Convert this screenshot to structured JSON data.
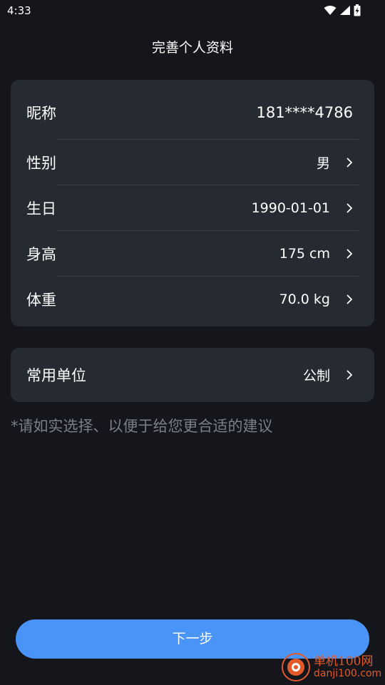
{
  "status_bar": {
    "time": "4:33",
    "icons": [
      "wifi-icon",
      "signal-icon",
      "battery-icon"
    ]
  },
  "page": {
    "title": "完善个人资料"
  },
  "profile": {
    "nickname": {
      "label": "昵称",
      "value": "181****4786"
    },
    "gender": {
      "label": "性别",
      "value": "男"
    },
    "birthday": {
      "label": "生日",
      "value": "1990-01-01"
    },
    "height": {
      "label": "身高",
      "value": "175 cm"
    },
    "weight": {
      "label": "体重",
      "value": "70.0 kg"
    }
  },
  "units": {
    "label": "常用单位",
    "value": "公制"
  },
  "hint": "*请如实选择、以便于给您更合适的建议",
  "next_button": "下一步",
  "watermark": {
    "title": "单机100网",
    "url": "danji100.com"
  },
  "colors": {
    "background": "#14161b",
    "card": "#262a31",
    "accent": "#4a94f7",
    "hint_text": "#7a7f87",
    "watermark": "#e25a2a"
  }
}
